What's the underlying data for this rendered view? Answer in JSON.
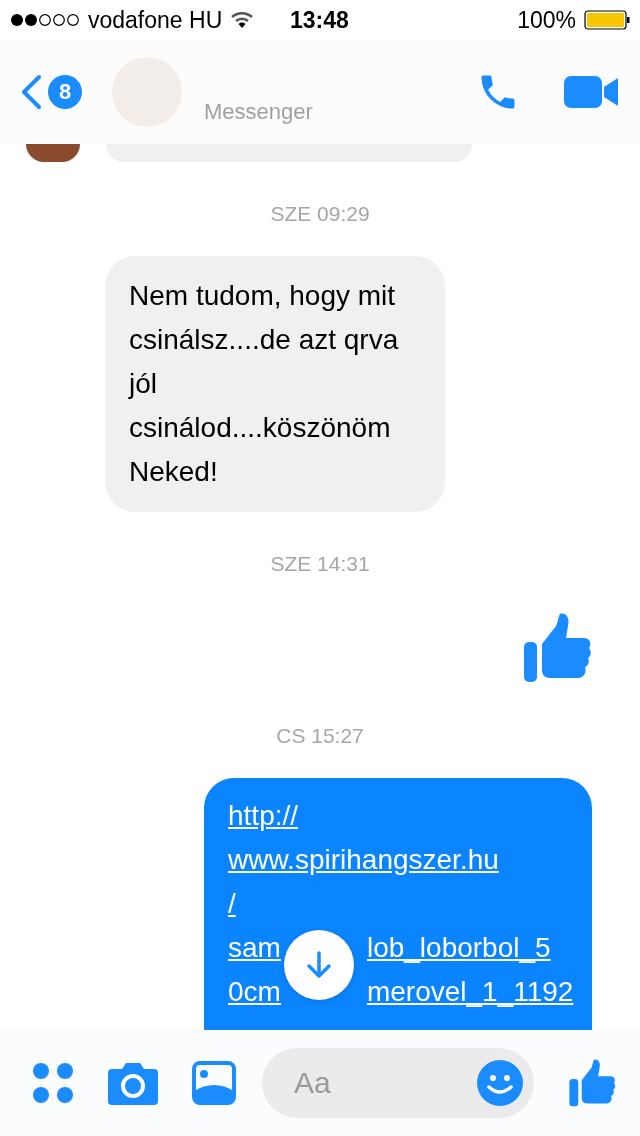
{
  "status_bar": {
    "carrier": "vodafone HU",
    "time": "13:48",
    "battery": "100%"
  },
  "header": {
    "back_count": "8",
    "subtitle": "Messenger"
  },
  "messages": [
    {
      "kind": "timestamp",
      "text": "SZE 09:29"
    },
    {
      "kind": "received",
      "text": "Nem tudom, hogy mit csinálsz....de azt qrva jól csinálod....köszönöm Neked!"
    },
    {
      "kind": "timestamp",
      "text": "SZE 14:31"
    },
    {
      "kind": "like"
    },
    {
      "kind": "timestamp",
      "text": "CS 15:27"
    },
    {
      "kind": "sent_link",
      "lines": [
        [
          "http://"
        ],
        [
          "www.spirihangszer.hu"
        ],
        [
          "/"
        ],
        [
          "sam",
          "lob_loborbol_5"
        ],
        [
          "0cm",
          "merovel_1_1192"
        ]
      ]
    }
  ],
  "composer": {
    "placeholder": "Aa"
  }
}
